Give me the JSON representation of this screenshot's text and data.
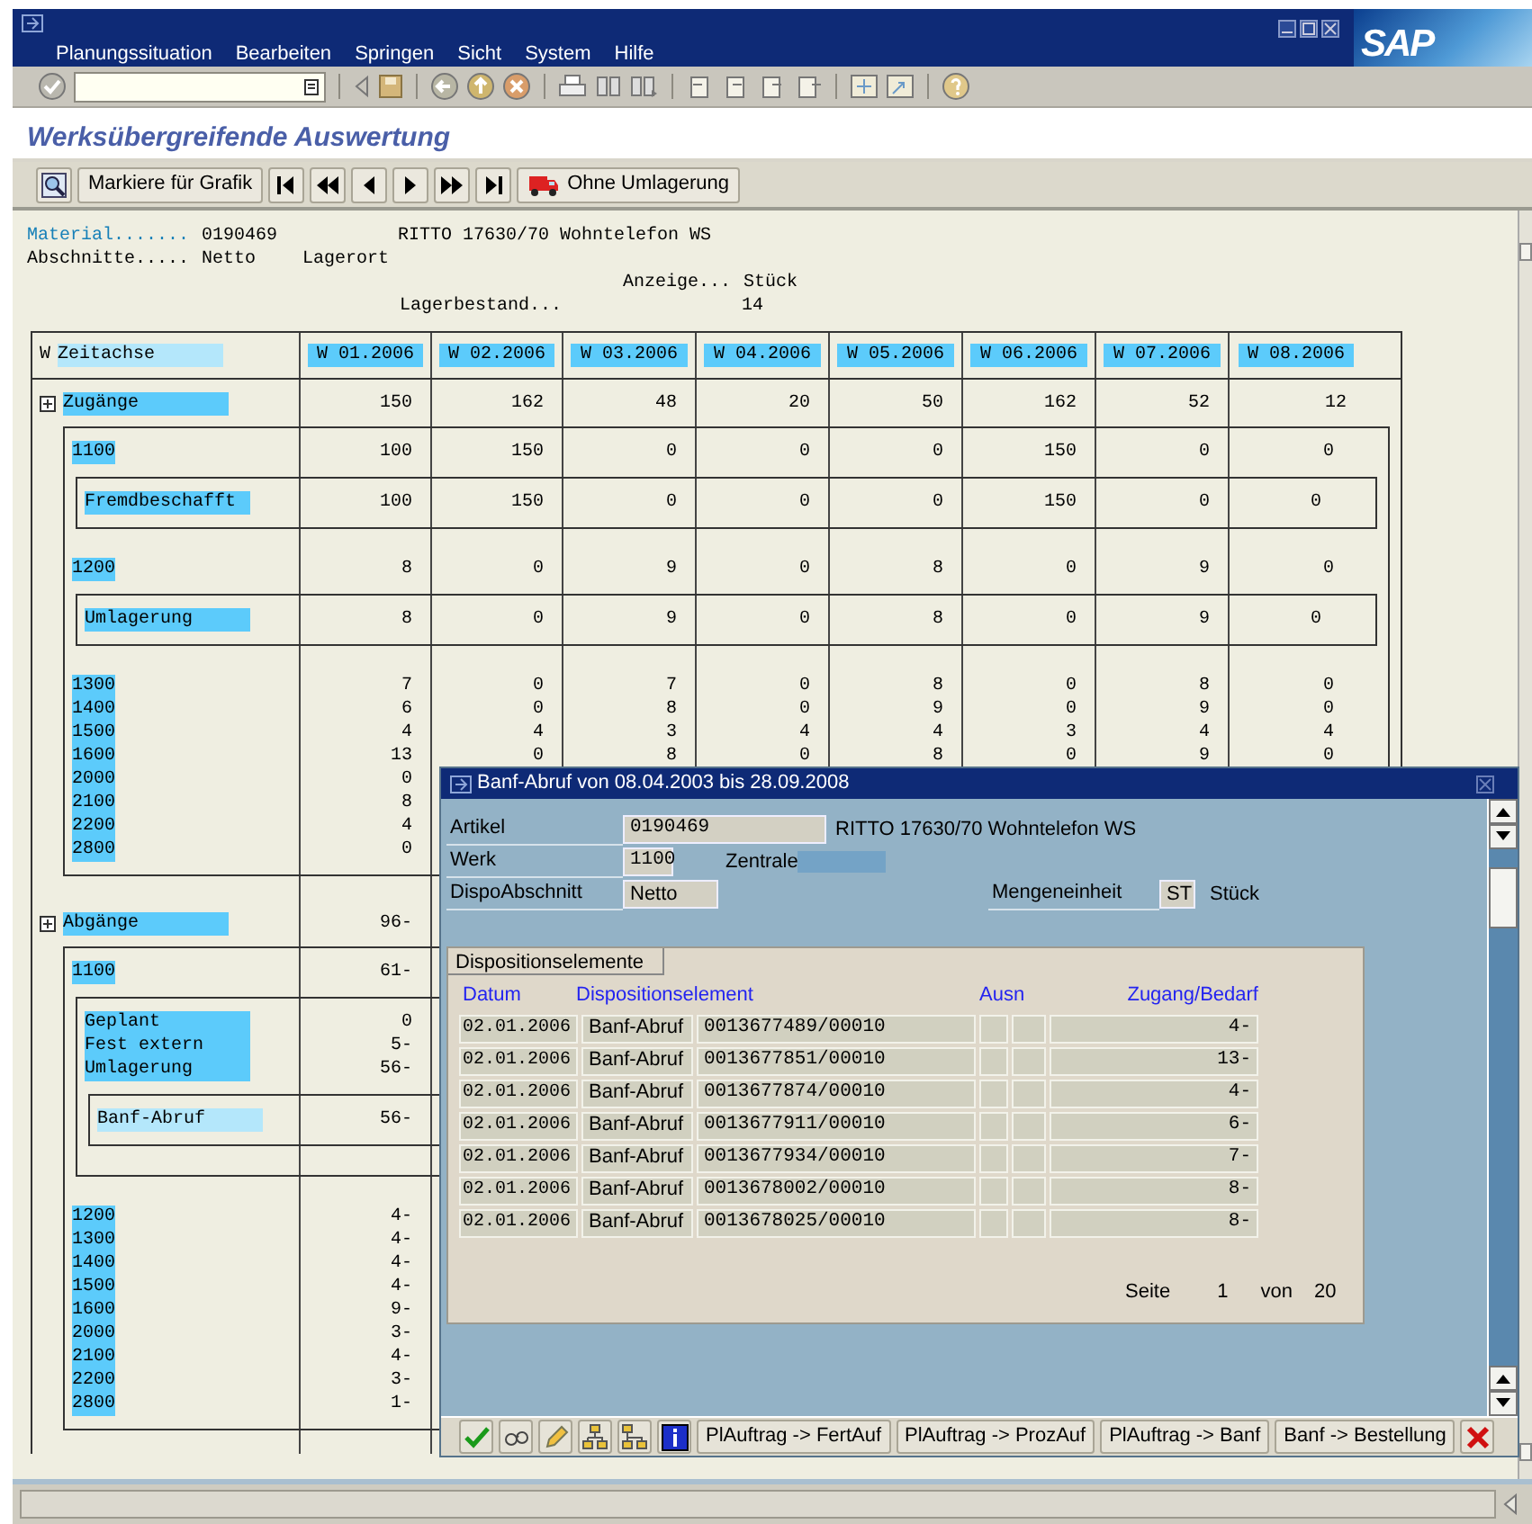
{
  "menu": [
    "Planungssituation",
    "Bearbeiten",
    "Springen",
    "Sicht",
    "System",
    "Hilfe"
  ],
  "logo": "SAP",
  "title": "Werksübergreifende Auswertung",
  "app_toolbar": {
    "mark_button": "Markiere für Grafik",
    "transfer_button": "Ohne Umlagerung"
  },
  "header": {
    "material_label": "Material.......",
    "material": "0190469",
    "material_text": "RITTO 17630/70 Wohntelefon WS",
    "sections_label": "Abschnitte.....",
    "sections": "Netto",
    "storage_label": "Lagerort",
    "display_label": "Anzeige...",
    "display": "Stück",
    "stock_label": "Lagerbestand...",
    "stock": "14"
  },
  "table": {
    "axis_marker": "W",
    "axis_label": "Zeitachse",
    "weeks": [
      "W 01.2006",
      "W 02.2006",
      "W 03.2006",
      "W 04.2006",
      "W 05.2006",
      "W 06.2006",
      "W 07.2006",
      "W 08.2006"
    ],
    "sections": [
      {
        "label": "Zugänge",
        "values": [
          "150",
          "162",
          "48",
          "20",
          "50",
          "162",
          "52",
          "12"
        ],
        "children": [
          {
            "label": "1100",
            "values": [
              "100",
              "150",
              "0",
              "0",
              "0",
              "150",
              "0",
              "0"
            ],
            "children": [
              {
                "label": "Fremdbeschafft",
                "values": [
                  "100",
                  "150",
                  "0",
                  "0",
                  "0",
                  "150",
                  "0",
                  "0"
                ]
              }
            ]
          },
          {
            "label": "1200",
            "values": [
              "8",
              "0",
              "9",
              "0",
              "8",
              "0",
              "9",
              "0"
            ],
            "children": [
              {
                "label": "Umlagerung",
                "values": [
                  "8",
                  "0",
                  "9",
                  "0",
                  "8",
                  "0",
                  "9",
                  "0"
                ]
              }
            ]
          },
          {
            "label": "1300",
            "values": [
              "7",
              "0",
              "7",
              "0",
              "8",
              "0",
              "8",
              "0"
            ]
          },
          {
            "label": "1400",
            "values": [
              "6",
              "0",
              "8",
              "0",
              "9",
              "0",
              "9",
              "0"
            ]
          },
          {
            "label": "1500",
            "values": [
              "4",
              "4",
              "3",
              "4",
              "4",
              "3",
              "4",
              "4"
            ]
          },
          {
            "label": "1600",
            "values": [
              "13",
              "0",
              "8",
              "0",
              "8",
              "0",
              "9",
              "0"
            ]
          },
          {
            "label": "2000",
            "values": [
              "0"
            ]
          },
          {
            "label": "2100",
            "values": [
              "8"
            ]
          },
          {
            "label": "2200",
            "values": [
              "4"
            ]
          },
          {
            "label": "2800",
            "values": [
              "0"
            ]
          }
        ]
      },
      {
        "label": "Abgänge",
        "values": [
          "96-"
        ],
        "children": [
          {
            "label": "1100",
            "values": [
              "61-"
            ],
            "children": [
              {
                "label": "Geplant",
                "values": [
                  "0"
                ]
              },
              {
                "label": "Fest extern",
                "values": [
                  "5-"
                ]
              },
              {
                "label": "Umlagerung",
                "values": [
                  "56-"
                ],
                "children": [
                  {
                    "label": "Banf-Abruf",
                    "values": [
                      "56-"
                    ]
                  }
                ]
              }
            ]
          },
          {
            "label": "1200",
            "values": [
              "4-"
            ]
          },
          {
            "label": "1300",
            "values": [
              "4-"
            ]
          },
          {
            "label": "1400",
            "values": [
              "4-"
            ]
          },
          {
            "label": "1500",
            "values": [
              "4-"
            ]
          },
          {
            "label": "1600",
            "values": [
              "9-"
            ]
          },
          {
            "label": "2000",
            "values": [
              "3-"
            ]
          },
          {
            "label": "2100",
            "values": [
              "4-"
            ]
          },
          {
            "label": "2200",
            "values": [
              "3-"
            ]
          },
          {
            "label": "2800",
            "values": [
              "1-"
            ]
          }
        ]
      }
    ]
  },
  "dialog": {
    "title": "Banf-Abruf von 08.04.2003 bis 28.09.2008",
    "article_label": "Artikel",
    "article": "0190469",
    "article_text": "RITTO 17630/70 Wohntelefon WS",
    "plant_label": "Werk",
    "plant": "1100",
    "central_label": "Zentrale",
    "segment_label": "DispoAbschnitt",
    "segment": "Netto",
    "unit_label": "Mengeneinheit",
    "unit": "ST",
    "unit_text": "Stück",
    "tab": "Dispositionselemente",
    "columns": [
      "Datum",
      "Dispositionselement",
      "Ausn",
      "Zugang/Bedarf"
    ],
    "rows": [
      {
        "date": "02.01.2006",
        "element": "Banf-Abruf",
        "number": "0013677489/00010",
        "quantity": "4-"
      },
      {
        "date": "02.01.2006",
        "element": "Banf-Abruf",
        "number": "0013677851/00010",
        "quantity": "13-"
      },
      {
        "date": "02.01.2006",
        "element": "Banf-Abruf",
        "number": "0013677874/00010",
        "quantity": "4-"
      },
      {
        "date": "02.01.2006",
        "element": "Banf-Abruf",
        "number": "0013677911/00010",
        "quantity": "6-"
      },
      {
        "date": "02.01.2006",
        "element": "Banf-Abruf",
        "number": "0013677934/00010",
        "quantity": "7-"
      },
      {
        "date": "02.01.2006",
        "element": "Banf-Abruf",
        "number": "0013678002/00010",
        "quantity": "8-"
      },
      {
        "date": "02.01.2006",
        "element": "Banf-Abruf",
        "number": "0013678025/00010",
        "quantity": "8-"
      }
    ],
    "pager": {
      "label": "Seite",
      "page": "1",
      "of_label": "von",
      "pages": "20"
    },
    "buttons": [
      "PlAuftrag -> FertAuf",
      "PlAuftrag -> ProzAuf",
      "PlAuftrag -> Banf",
      "Banf -> Bestellung"
    ]
  }
}
